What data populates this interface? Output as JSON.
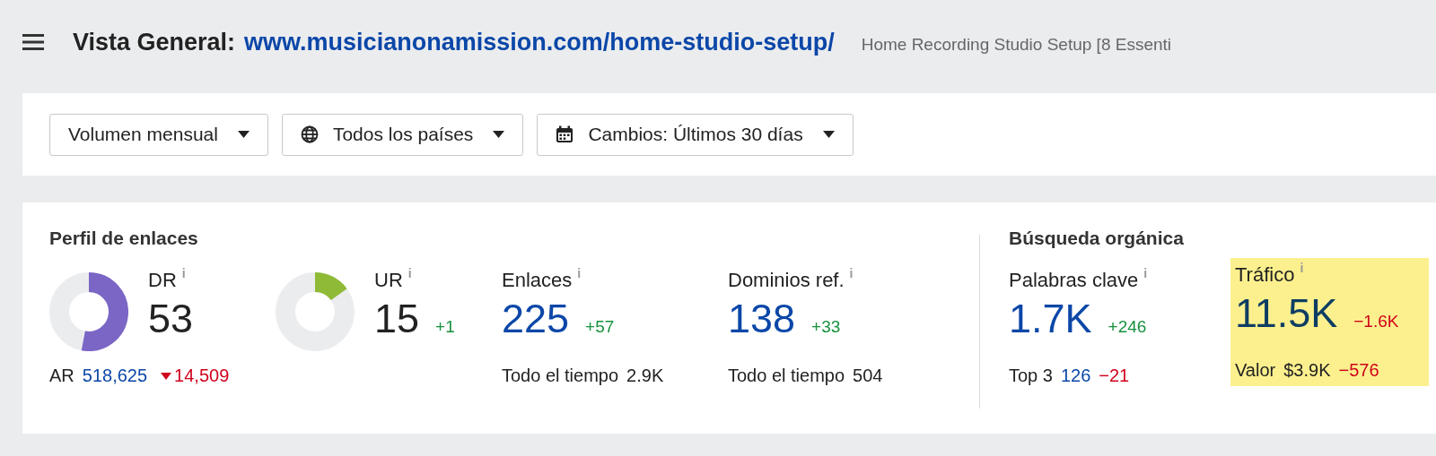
{
  "header": {
    "title": "Vista General:",
    "url": "www.musicianonamission.com/home-studio-setup/",
    "page_title": "Home Recording Studio Setup [8 Essenti"
  },
  "filters": [
    {
      "label": "Volumen mensual",
      "kind": "plain"
    },
    {
      "label": "Todos los países",
      "kind": "globe"
    },
    {
      "label": "Cambios: Últimos 30 días",
      "kind": "calendar"
    }
  ],
  "sections": [
    {
      "title": "Perfil de enlaces",
      "metrics": [
        {
          "kind": "ring",
          "label": "DR",
          "info": "i",
          "value": "53",
          "color": "#7b66c6",
          "sub": [
            {
              "text": "AR",
              "kind": "label"
            },
            {
              "text": "518,625",
              "kind": "link"
            },
            {
              "text": "14,509",
              "kind": "drop"
            }
          ]
        },
        {
          "kind": "ring",
          "label": "UR",
          "info": "i",
          "value": "15",
          "color": "#8fba36",
          "change": {
            "text": "+1",
            "kind": "increase"
          }
        },
        {
          "kind": "count",
          "label": "Enlaces",
          "info": "i",
          "value": "225",
          "change": {
            "text": "+57",
            "kind": "increase"
          },
          "sub": [
            {
              "text": "Todo el tiempo",
              "kind": "label"
            },
            {
              "text": "2.9K",
              "kind": "label"
            }
          ]
        },
        {
          "kind": "count",
          "label": "Dominios ref.",
          "info": "i",
          "value": "138",
          "change": {
            "text": "+33",
            "kind": "increase"
          },
          "sub": [
            {
              "text": "Todo el tiempo",
              "kind": "label"
            },
            {
              "text": "504",
              "kind": "label"
            }
          ]
        }
      ]
    },
    {
      "title": "Búsqueda orgánica",
      "metrics": [
        {
          "kind": "count",
          "label": "Palabras clave",
          "info": "i",
          "value": "1.7K",
          "change": {
            "text": "+246",
            "kind": "increase"
          },
          "sub": [
            {
              "text": "Top 3",
              "kind": "label"
            },
            {
              "text": "126",
              "kind": "link"
            },
            {
              "text": "−21",
              "kind": "down"
            }
          ]
        },
        {
          "kind": "count",
          "label": "Tráfico",
          "info": "i",
          "value": "11.5K",
          "highlighted": true,
          "change": {
            "text": "−1.6K",
            "kind": "decrease"
          },
          "sub": [
            {
              "text": "Valor",
              "kind": "label"
            },
            {
              "text": "$3.9K",
              "kind": "label"
            },
            {
              "text": "−576",
              "kind": "down"
            }
          ]
        }
      ]
    }
  ]
}
